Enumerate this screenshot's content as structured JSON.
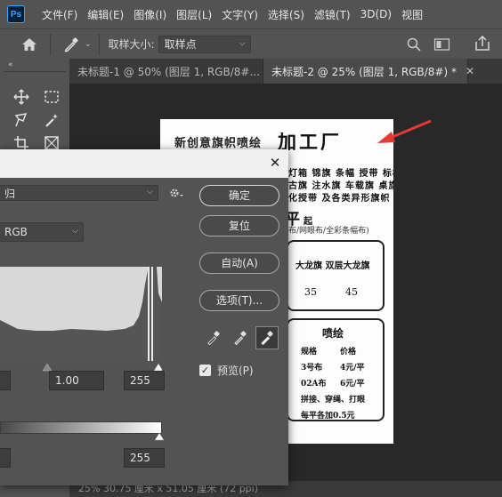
{
  "app": {
    "logo": "Ps"
  },
  "menu": {
    "items": [
      "文件(F)",
      "编辑(E)",
      "图像(I)",
      "图层(L)",
      "文字(Y)",
      "选择(S)",
      "滤镜(T)",
      "3D(D)",
      "视图"
    ]
  },
  "options": {
    "sample_size_label": "取样大小:",
    "sample_size_value": "取样点"
  },
  "tabs": [
    {
      "label": "未标题-1 @ 50% (图层 1, RGB/8#...",
      "active": false
    },
    {
      "label": "未标题-2 @ 25% (图层 1, RGB/8#) *",
      "active": true
    }
  ],
  "poster": {
    "line1": "新创意旗帜喷绘",
    "line2": "加工厂",
    "line3": "灯箱 锦旗 条幅 授带 标标",
    "line4": "古旗 注水旗 车载旗 桌旗",
    "line5": "化授带 及各类异形旗帜",
    "price_main": "平",
    "price_suffix": "起",
    "note": "布/网眼布/全彩条幅布)",
    "box1": {
      "header": "大龙旗  双层大龙旗",
      "v1": "35",
      "v2": "45"
    },
    "box2": {
      "title": "喷绘",
      "rows": [
        {
          "a": "规格",
          "b": "价格"
        },
        {
          "a": "3号布",
          "b": "4元/平"
        },
        {
          "a": "02A布",
          "b": "6元/平"
        },
        {
          "a": "拼接、穿绳、打眼",
          "b": ""
        },
        {
          "a": "每平各加0.5元",
          "b": ""
        }
      ]
    }
  },
  "dialog": {
    "channel": "RGB",
    "buttons": {
      "ok": "确定",
      "reset": "复位",
      "auto": "自动(A)",
      "options": "选项(T)..."
    },
    "input_gamma": "1.00",
    "input_white": "255",
    "output_white": "255",
    "preview_label": "预览(P)",
    "preview_checked": true
  },
  "status": {
    "text": "25%   30.75 厘米 x 51.05 厘米 (72 ppi)"
  },
  "colors": {
    "accent_arrow": "#e53935"
  }
}
